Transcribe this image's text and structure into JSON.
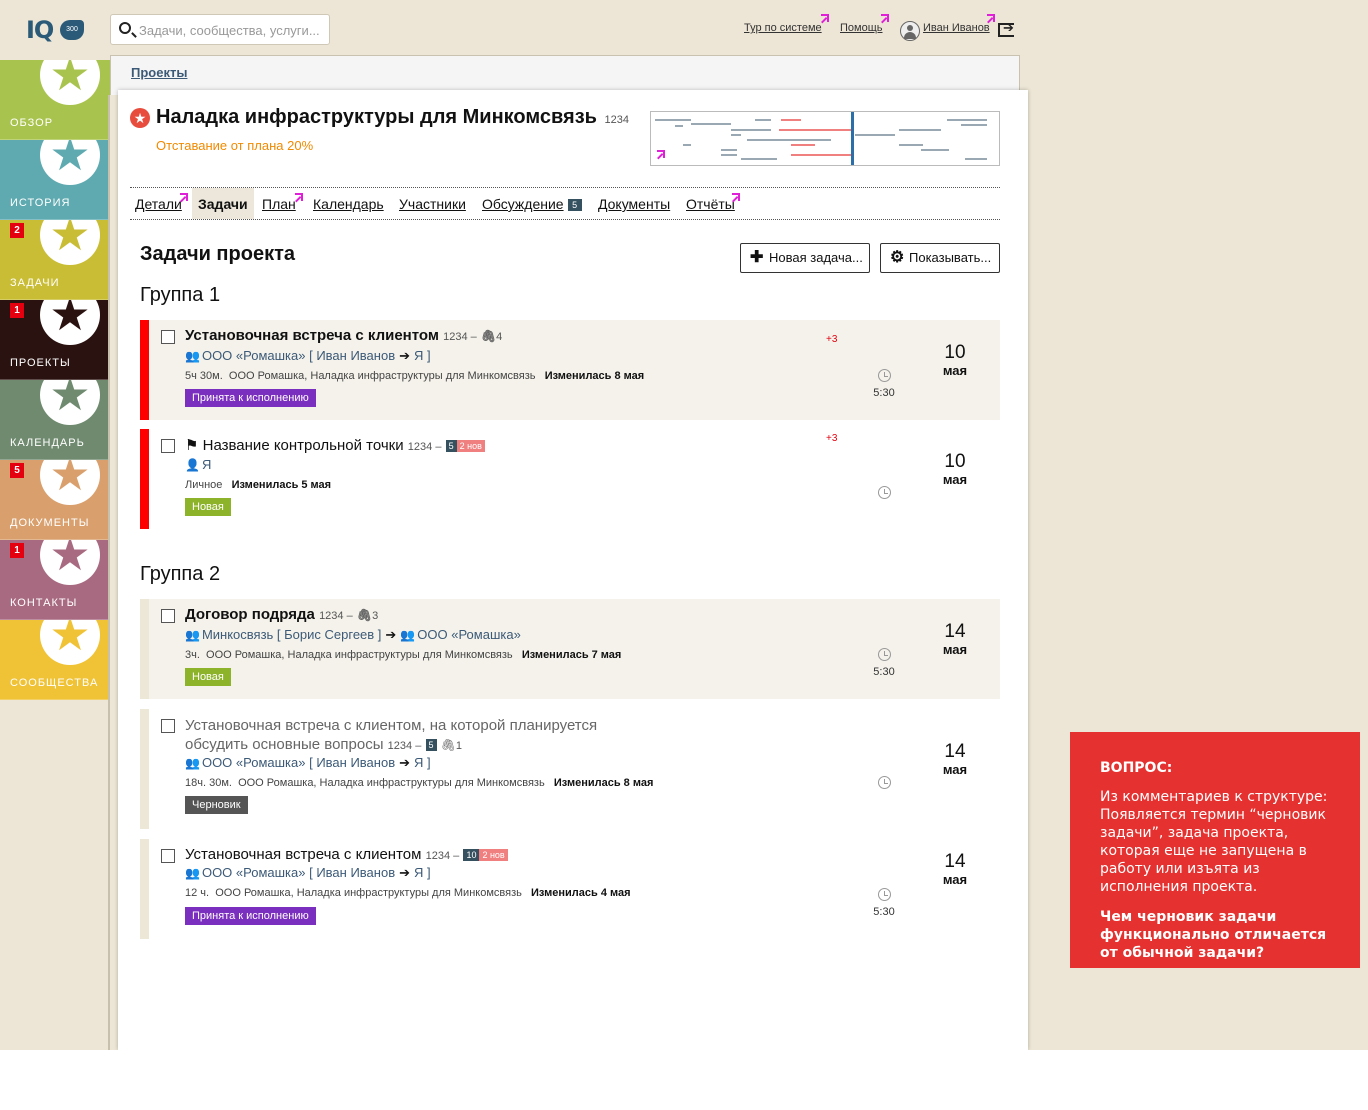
{
  "header": {
    "logo_text": "IQ",
    "logo_badge": "300",
    "search_placeholder": "Задачи, сообщества, услуги...",
    "tour_link": "Тур по системе",
    "help_link": "Помощь",
    "user_name": "Иван Иванов"
  },
  "sidebar": {
    "items": [
      {
        "label": "ОБЗОР",
        "badge": "",
        "color": "#a9c44e",
        "star_color": "#a9c44e"
      },
      {
        "label": "ИСТОРИЯ",
        "badge": "",
        "color": "#5eaab0",
        "star_color": "#5eaab0"
      },
      {
        "label": "ЗАДАЧИ",
        "badge": "2",
        "color": "#c9bd35",
        "star_color": "#c9bd35"
      },
      {
        "label": "ПРОЕКТЫ",
        "badge": "1",
        "color": "#2a1210",
        "star_color": "#2a1210"
      },
      {
        "label": "КАЛЕНДАРЬ",
        "badge": "",
        "color": "#6f8a6f",
        "star_color": "#6f8a6f"
      },
      {
        "label": "ДОКУМЕНТЫ",
        "badge": "5",
        "color": "#d9a06e",
        "star_color": "#d9a06e"
      },
      {
        "label": "КОНТАКТЫ",
        "badge": "1",
        "color": "#a86a80",
        "star_color": "#a86a80"
      },
      {
        "label": "СООБЩЕСТВА",
        "badge": "",
        "color": "#f0c236",
        "star_color": "#f0c236"
      }
    ]
  },
  "breadcrumb": "Проекты",
  "project": {
    "title": "Наладка инфраструктуры для Минкомсвязь",
    "id": "1234",
    "lag": "Отставание от плана 20%"
  },
  "tabs": [
    {
      "label": "Детали"
    },
    {
      "label": "Задачи"
    },
    {
      "label": "План"
    },
    {
      "label": "Календарь"
    },
    {
      "label": "Участники"
    },
    {
      "label": "Обсуждение",
      "count": "5"
    },
    {
      "label": "Документы"
    },
    {
      "label": "Отчёты"
    }
  ],
  "main": {
    "section_title": "Задачи проекта",
    "new_task_button": "Новая задача...",
    "show_button": "Показывать...",
    "groups": [
      {
        "title": "Группа 1"
      },
      {
        "title": "Группа 2"
      }
    ]
  },
  "tasks": [
    {
      "title": "Установочная встреча с клиентом",
      "id": "1234 –",
      "attachments": "4",
      "from": "ООО «Ромашка» [ Иван Иванов",
      "to": "Я ]",
      "duration_text": "5ч 30м.",
      "context": "ООО Ромашка, Наладка инфраструктуры для Минкомсвязь",
      "changed": "Изменилась 8 мая",
      "status": "Принята к исполнению",
      "status_color": "#7b2fbe",
      "extra": "+3",
      "time": "5:30",
      "day": "10",
      "month": "мая",
      "stripe": "#ff0000"
    },
    {
      "title": "Название контрольной точки",
      "id": "1234 –",
      "comments": "5",
      "new_comments": "2 нов",
      "assignee": "Я",
      "context": "Личное",
      "changed": "Изменилась 5 мая",
      "status": "Новая",
      "status_color": "#8db32b",
      "extra": "+3",
      "time": "",
      "day": "10",
      "month": "мая",
      "stripe": "#ff0000"
    },
    {
      "title": "Договор подряда",
      "id": "1234 –",
      "attachments": "3",
      "from": "Минкосвязь [ Борис Сергеев ]",
      "to": "ООО «Ромашка»",
      "duration_text": "3ч.",
      "context": "ООО Ромашка, Наладка инфраструктуры для Минкомсвязь",
      "changed": "Изменилась 7 мая",
      "status": "Новая",
      "status_color": "#8db32b",
      "time": "5:30",
      "day": "14",
      "month": "мая",
      "stripe": "#ece7d6"
    },
    {
      "title": "Установочная встреча с клиентом, на которой планируется обсудить основные вопросы",
      "id": "1234 –",
      "comments": "5",
      "attachments": "1",
      "from": "ООО «Ромашка» [ Иван Иванов",
      "to": "Я ]",
      "duration_text": "18ч. 30м.",
      "context": "ООО Ромашка, Наладка инфраструктуры для Минкомсвязь",
      "changed": "Изменилась 8 мая",
      "status": "Черновик",
      "status_color": "#555555",
      "time": "",
      "day": "14",
      "month": "мая",
      "stripe": "#ece7d6"
    },
    {
      "title": "Установочная встреча с клиентом",
      "id": "1234 –",
      "comments": "10",
      "new_comments": "2 нов",
      "from": "ООО «Ромашка» [ Иван Иванов",
      "to": "Я ]",
      "duration_text": "12 ч.",
      "context": "ООО Ромашка, Наладка инфраструктуры для Минкомсвязь",
      "changed": "Изменилась 4 мая",
      "status": "Принята к исполнению",
      "status_color": "#7b2fbe",
      "time": "5:30",
      "day": "14",
      "month": "мая",
      "stripe": "#ece7d6"
    }
  ],
  "question_box": {
    "heading": "ВОПРОС:",
    "text": "Из комментариев к структуре: Появляется термин “черновик задачи”, задача проекта, которая еще не запущена в работу или изъята из исполнения проекта.",
    "question": "Чем черновик задачи функционально отличается от обычной задачи?"
  }
}
